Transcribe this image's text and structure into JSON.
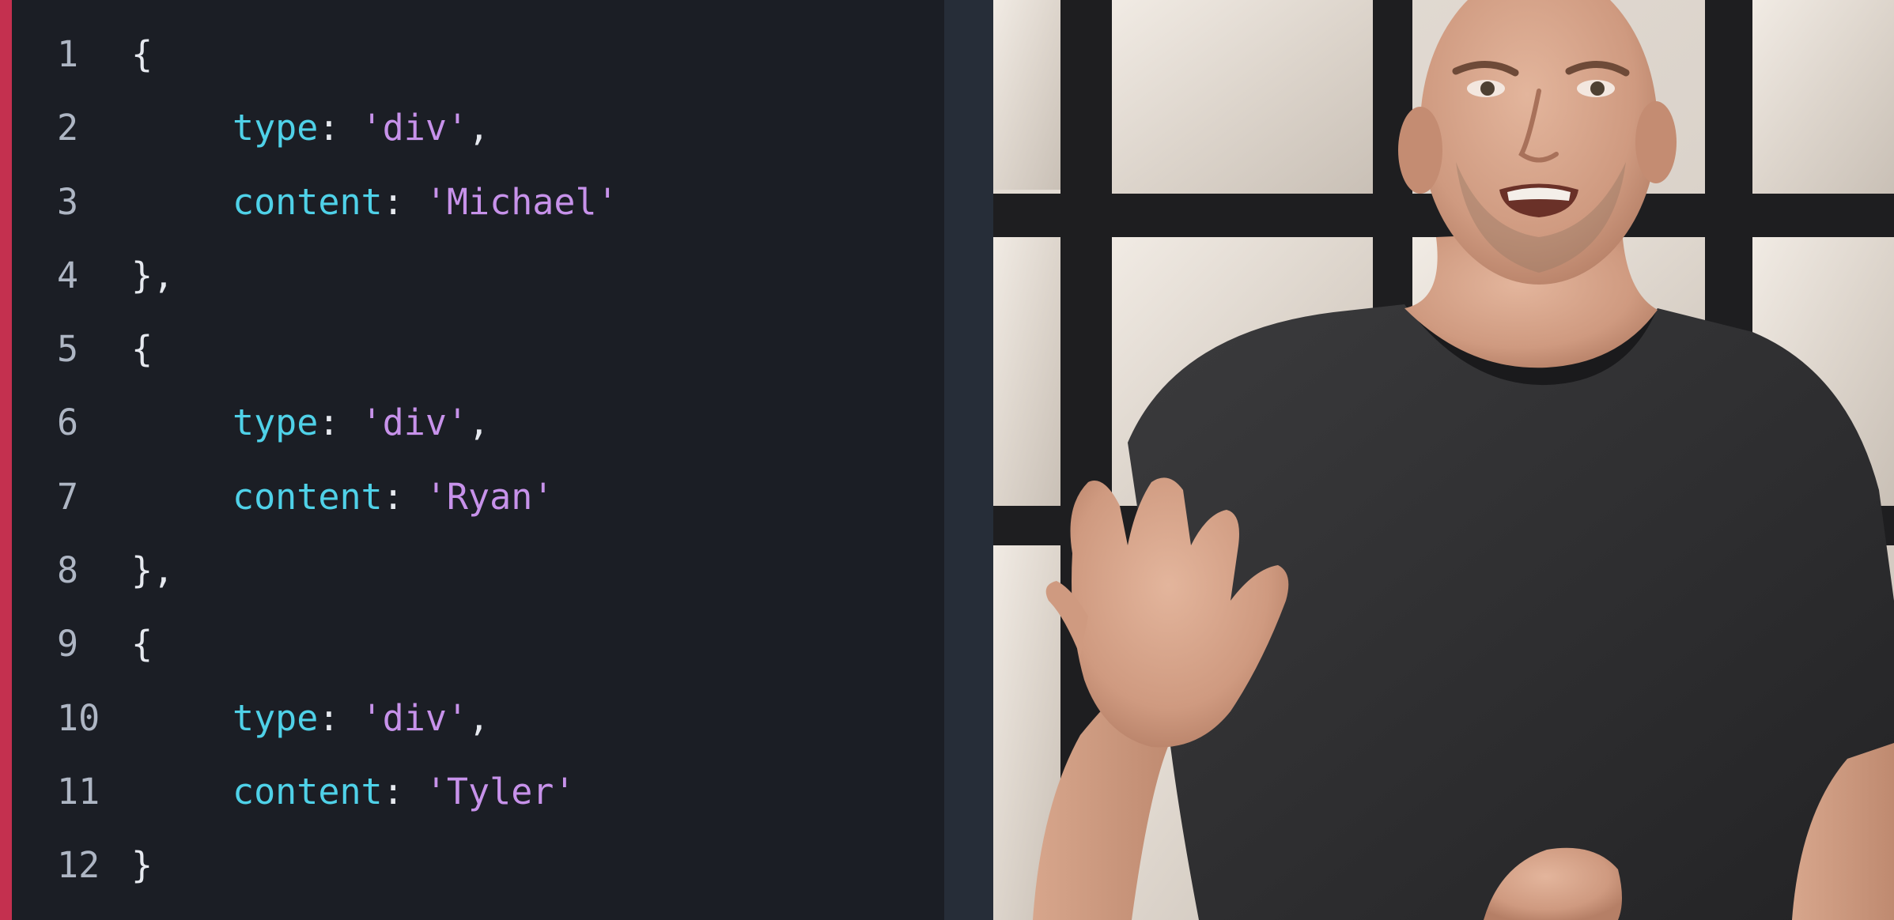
{
  "code_editor": {
    "lines": [
      {
        "number": "1",
        "indent": 0,
        "tokens": [
          {
            "t": "punct",
            "v": "{"
          }
        ]
      },
      {
        "number": "2",
        "indent": 1,
        "tokens": [
          {
            "t": "key",
            "v": "type"
          },
          {
            "t": "punct",
            "v": ": "
          },
          {
            "t": "str",
            "v": "'div'"
          },
          {
            "t": "punct",
            "v": ","
          }
        ]
      },
      {
        "number": "3",
        "indent": 1,
        "tokens": [
          {
            "t": "key",
            "v": "content"
          },
          {
            "t": "punct",
            "v": ": "
          },
          {
            "t": "str",
            "v": "'Michael'"
          }
        ]
      },
      {
        "number": "4",
        "indent": 0,
        "tokens": [
          {
            "t": "punct",
            "v": "},"
          }
        ]
      },
      {
        "number": "5",
        "indent": 0,
        "tokens": [
          {
            "t": "punct",
            "v": "{"
          }
        ]
      },
      {
        "number": "6",
        "indent": 1,
        "tokens": [
          {
            "t": "key",
            "v": "type"
          },
          {
            "t": "punct",
            "v": ": "
          },
          {
            "t": "str",
            "v": "'div'"
          },
          {
            "t": "punct",
            "v": ","
          }
        ]
      },
      {
        "number": "7",
        "indent": 1,
        "tokens": [
          {
            "t": "key",
            "v": "content"
          },
          {
            "t": "punct",
            "v": ": "
          },
          {
            "t": "str",
            "v": "'Ryan'"
          }
        ]
      },
      {
        "number": "8",
        "indent": 0,
        "tokens": [
          {
            "t": "punct",
            "v": "},"
          }
        ]
      },
      {
        "number": "9",
        "indent": 0,
        "tokens": [
          {
            "t": "punct",
            "v": "{"
          }
        ]
      },
      {
        "number": "10",
        "indent": 1,
        "tokens": [
          {
            "t": "key",
            "v": "type"
          },
          {
            "t": "punct",
            "v": ": "
          },
          {
            "t": "str",
            "v": "'div'"
          },
          {
            "t": "punct",
            "v": ","
          }
        ]
      },
      {
        "number": "11",
        "indent": 1,
        "tokens": [
          {
            "t": "key",
            "v": "content"
          },
          {
            "t": "punct",
            "v": ": "
          },
          {
            "t": "str",
            "v": "'Tyler'"
          }
        ]
      },
      {
        "number": "12",
        "indent": 0,
        "tokens": [
          {
            "t": "punct",
            "v": "}"
          }
        ]
      }
    ]
  },
  "colors": {
    "editor_background": "#1b1e25",
    "accent_bar": "#c4304f",
    "line_number": "#aeb6c4",
    "punctuation": "#e6e9ef",
    "key": "#4fd1e8",
    "string": "#c792ea",
    "gutter": "#262d38"
  },
  "video": {
    "icon": "presenter-video-frame"
  }
}
